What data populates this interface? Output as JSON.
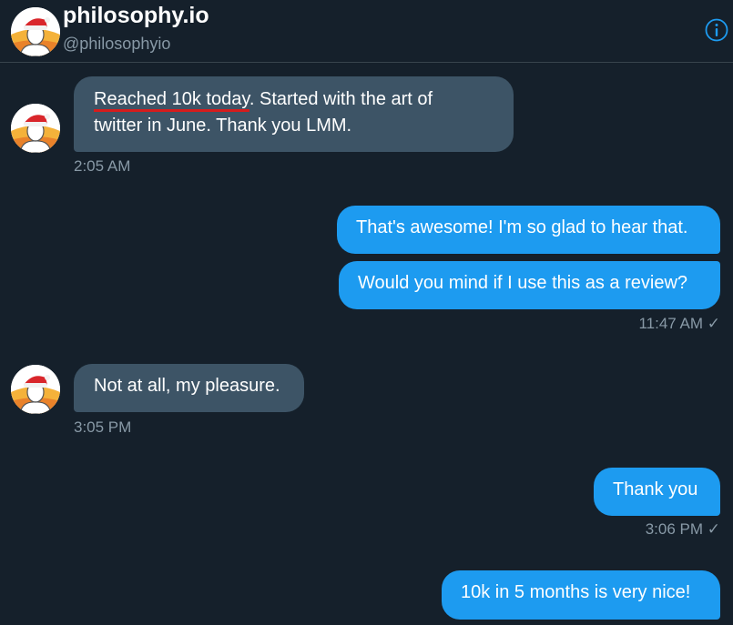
{
  "header": {
    "name": "philosophy.io",
    "handle": "@philosophyio",
    "info_icon": "info-icon"
  },
  "messages": [
    {
      "direction": "in",
      "underlined": "Reached 10k today",
      "text_rest": ". Started with the art of",
      "text_line2": "twitter in June. Thank you LMM.",
      "time": "2:05 AM"
    },
    {
      "direction": "out",
      "text": "That's awesome! I'm so glad to hear that."
    },
    {
      "direction": "out",
      "text": "Would you mind if I use this as a review?",
      "time": "11:47 AM ✓"
    },
    {
      "direction": "in",
      "text": "Not at all, my pleasure.",
      "time": "3:05 PM"
    },
    {
      "direction": "out",
      "text": "Thank you",
      "time": "3:06 PM ✓"
    },
    {
      "direction": "out",
      "text": "10k in 5 months is very nice!"
    }
  ],
  "colors": {
    "background": "#15202b",
    "incoming_bubble": "#3d5466",
    "outgoing_bubble": "#1d9bf0",
    "underline": "#d61c1c",
    "muted_text": "#8899a6"
  }
}
